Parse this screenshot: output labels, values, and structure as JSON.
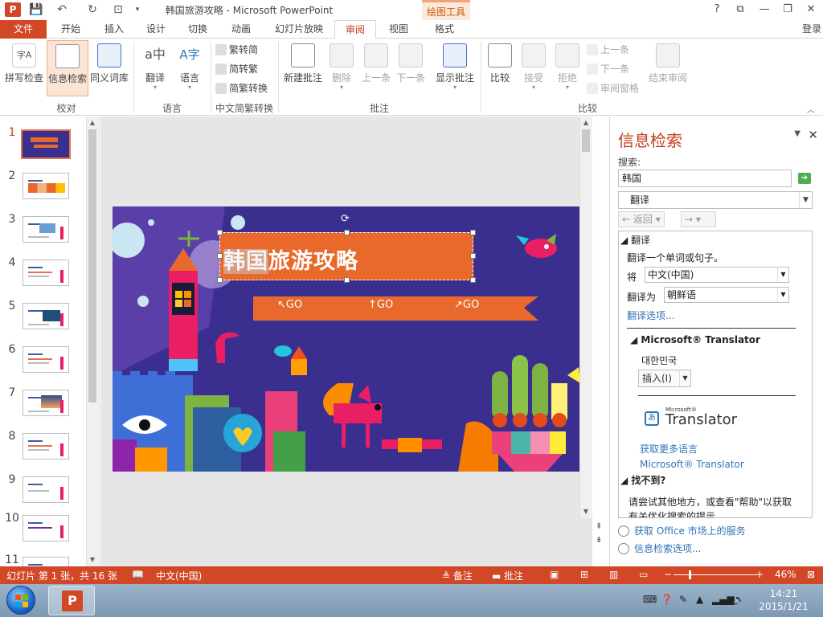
{
  "window": {
    "title": "韩国旅游攻略 - Microsoft PowerPoint",
    "tools_tab": "绘图工具",
    "app_icon": "P",
    "help": "?",
    "controls": [
      "?",
      "⧉",
      "—",
      "❐",
      "✕"
    ]
  },
  "tabs": {
    "file": "文件",
    "items": [
      "开始",
      "插入",
      "设计",
      "切换",
      "动画",
      "幻灯片放映",
      "审阅",
      "视图",
      "格式"
    ],
    "active": "审阅",
    "login": "登录"
  },
  "ribbon": {
    "proofing": {
      "spell": "拼写检查",
      "research": "信息检索",
      "thesaurus": "同义词库",
      "label": "校对"
    },
    "language": {
      "translate": "翻译",
      "language": "语言",
      "label": "语言"
    },
    "chinese": {
      "t2s": "繁转简",
      "s2t": "简转繁",
      "convert": "简繁转换",
      "label": "中文简繁转换"
    },
    "comments": {
      "new": "新建批注",
      "delete": "删除",
      "prev": "上一条",
      "next": "下一条",
      "show": "显示批注",
      "label": "批注"
    },
    "compare": {
      "compare": "比较",
      "accept": "接受",
      "reject": "拒绝",
      "prev": "上一条",
      "next": "下一条",
      "pane": "审阅窗格",
      "end": "结束审阅",
      "label": "比较"
    }
  },
  "thumbnails": [
    "1",
    "2",
    "3",
    "4",
    "5",
    "6",
    "7",
    "8",
    "9",
    "10",
    "11"
  ],
  "slide": {
    "title_highlight": "韩国",
    "title_rest": "旅游攻略",
    "go_labels": [
      "↖GO",
      "↑GO",
      "↗GO"
    ]
  },
  "research_pane": {
    "title": "信息检索",
    "search_label": "搜索:",
    "search_value": "韩国",
    "service": "翻译",
    "back": "返回",
    "forward": "→",
    "section_translate": "翻译",
    "translate_hint": "翻译一个单词或句子。",
    "from_label": "将",
    "from_value": "中文(中国)",
    "to_label": "翻译为",
    "to_value": "朝鲜语",
    "options_link": "翻译选项...",
    "ms_translator": "Microsoft® Translator",
    "result": "대한민국",
    "insert": "插入(I)",
    "logo_small": "Microsoft®",
    "logo_big": "Translator",
    "more_langs": "获取更多语言",
    "ms_link": "Microsoft® Translator",
    "not_found": "找不到?",
    "not_found_text_1": "请尝试其他地方，或查看\"帮助\"以获取",
    "not_found_text_2": "有关优化搜索的提示。",
    "footer_1": "获取 Office 市场上的服务",
    "footer_2": "信息检索选项..."
  },
  "status": {
    "slide_info": "幻灯片 第 1 张，共 16 张",
    "language": "中文(中国)",
    "notes": "备注",
    "comments": "批注",
    "zoom": "46%"
  },
  "taskbar": {
    "time": "14:21",
    "date": "2015/1/21"
  }
}
